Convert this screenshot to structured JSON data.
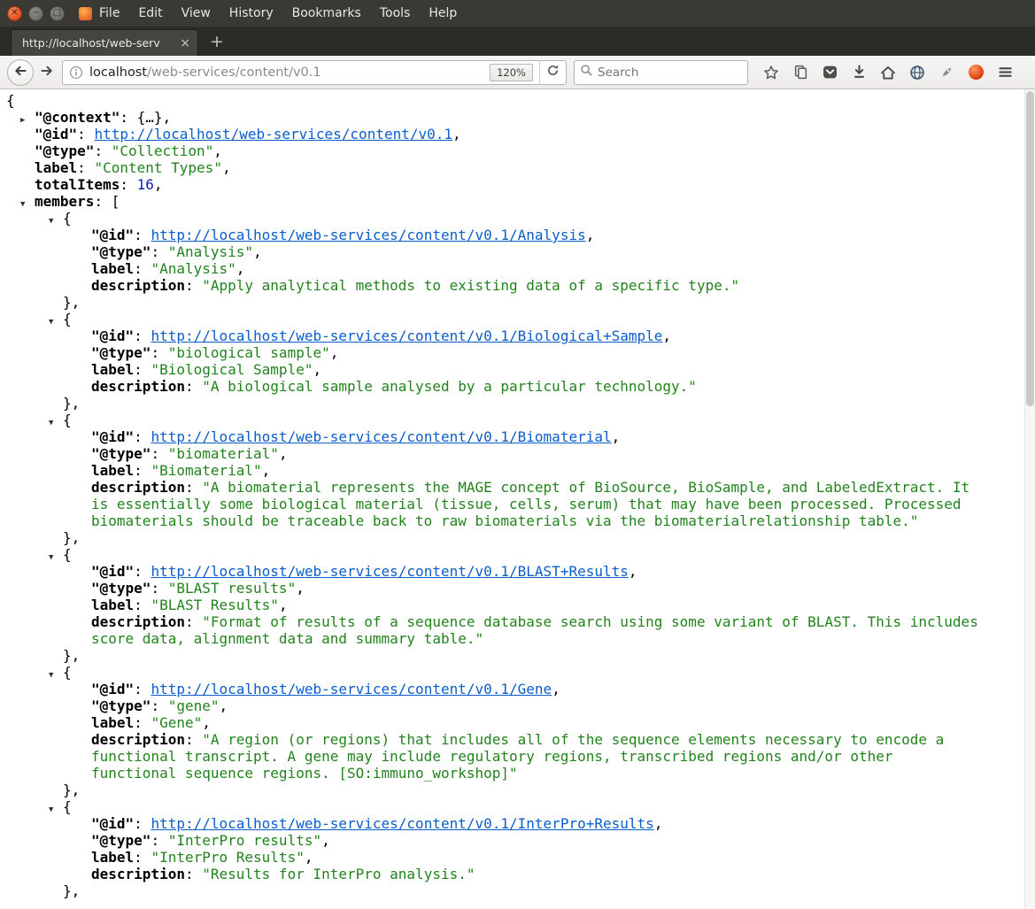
{
  "window": {
    "menu_items": [
      "File",
      "Edit",
      "View",
      "History",
      "Bookmarks",
      "Tools",
      "Help"
    ],
    "buttons": {
      "close": "✕",
      "minimize": "−",
      "maximize": "□"
    }
  },
  "tabbar": {
    "active_tab_title": "http://localhost/web-serv",
    "tab_close": "×",
    "new_tab": "+"
  },
  "navbar": {
    "url_host": "localhost",
    "url_path": "/web-services/content/v0.1",
    "zoom": "120%",
    "search_placeholder": "Search",
    "icons": [
      "back-arrow",
      "forward-arrow",
      "page-info",
      "reload",
      "search-magnifier",
      "bookmark-star",
      "clipboard",
      "pocket",
      "downloads",
      "home",
      "globe",
      "addon-rocket",
      "addon-red-ball",
      "hamburger-menu"
    ]
  },
  "colors": {
    "string": "#22831d",
    "number": "#121db5",
    "link": "#0b5dcc",
    "key": "#000000"
  },
  "json_document": {
    "root_open": "{",
    "colon": ": ",
    "comma": ",",
    "member_open": "{",
    "member_close": "},",
    "members_bracket": "[",
    "context_preview": "{…}",
    "collapsed_arrow": "▶",
    "expanded_arrow": "▼",
    "keys": {
      "context": "\"@context\"",
      "id": "\"@id\"",
      "type": "\"@type\"",
      "label": "label",
      "total": "totalItems",
      "members": "members",
      "description": "description"
    },
    "collection": {
      "id_url": "http://localhost/web-services/content/v0.1",
      "type": "Collection",
      "label": "Content Types",
      "total_items": "16"
    },
    "members": [
      {
        "id_url": "http://localhost/web-services/content/v0.1/Analysis",
        "type": "Analysis",
        "label": "Analysis",
        "description": "Apply analytical methods to existing data of a specific type."
      },
      {
        "id_url": "http://localhost/web-services/content/v0.1/Biological+Sample",
        "type": "biological sample",
        "label": "Biological Sample",
        "description": "A biological sample analysed by a particular technology."
      },
      {
        "id_url": "http://localhost/web-services/content/v0.1/Biomaterial",
        "type": "biomaterial",
        "label": "Biomaterial",
        "description": "A biomaterial represents the MAGE concept of BioSource, BioSample, and LabeledExtract. It is essentially some biological material (tissue, cells, serum) that may have been processed. Processed biomaterials should be traceable back to raw biomaterials via the biomaterialrelationship table."
      },
      {
        "id_url": "http://localhost/web-services/content/v0.1/BLAST+Results",
        "type": "BLAST results",
        "label": "BLAST Results",
        "description": "Format of results of a sequence database search using some variant of BLAST. This includes score data, alignment data and summary table."
      },
      {
        "id_url": "http://localhost/web-services/content/v0.1/Gene",
        "type": "gene",
        "label": "Gene",
        "description": "A region (or regions) that includes all of the sequence elements necessary to encode a functional transcript. A gene may include regulatory regions, transcribed regions and/or other functional sequence regions. [SO:immuno_workshop]"
      },
      {
        "id_url": "http://localhost/web-services/content/v0.1/InterPro+Results",
        "type": "InterPro results",
        "label": "InterPro Results",
        "description": "Results for InterPro analysis."
      }
    ]
  }
}
